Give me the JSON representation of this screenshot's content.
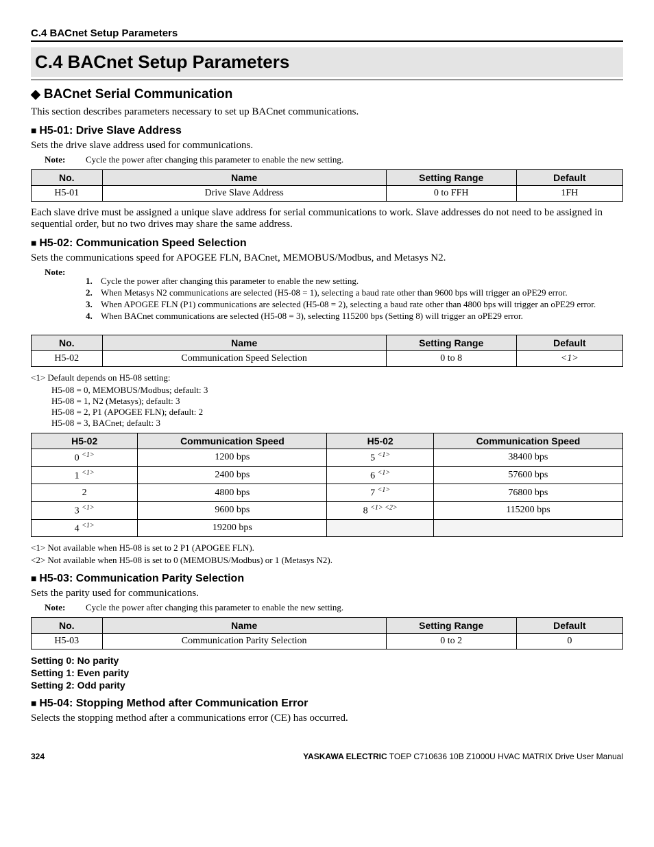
{
  "header": {
    "running_title": "C.4 BACnet Setup Parameters"
  },
  "title": "C.4   BACnet Setup Parameters",
  "s1": {
    "title": "BACnet Serial Communication",
    "intro": "This section describes parameters necessary to set up BACnet communications."
  },
  "h5_01": {
    "title": "H5-01: Drive Slave Address",
    "desc": "Sets the drive slave address used for communications.",
    "note": "Cycle the power after changing this parameter to enable the new setting.",
    "table": {
      "h_no": "No.",
      "h_name": "Name",
      "h_range": "Setting Range",
      "h_default": "Default",
      "no": "H5-01",
      "name": "Drive Slave Address",
      "range": "0 to FFH",
      "def": "1FH"
    },
    "after": "Each slave drive must be assigned a unique slave address for serial communications to work. Slave addresses do not need to be assigned in sequential order, but no two drives may share the same address."
  },
  "h5_02": {
    "title": "H5-02: Communication Speed Selection",
    "desc": "Sets the communications speed for APOGEE FLN, BACnet, MEMOBUS/Modbus, and Metasys N2.",
    "notes": [
      "Cycle the power after changing this parameter to enable the new setting.",
      "When Metasys N2 communications are selected (H5-08 = 1), selecting a baud rate other than 9600 bps will trigger an oPE29 error.",
      "When APOGEE FLN (P1) communications are selected (H5-08 = 2), selecting a baud rate other than 4800 bps will trigger an oPE29 error.",
      "When BACnet communications are selected (H5-08 = 3), selecting 115200 bps (Setting 8) will trigger an oPE29 error."
    ],
    "table": {
      "h_no": "No.",
      "h_name": "Name",
      "h_range": "Setting Range",
      "h_default": "Default",
      "no": "H5-02",
      "name": "Communication Speed Selection",
      "range": "0 to 8",
      "def": "<1>"
    },
    "fn1_lead": "<1>   Default depends on H5-08 setting:",
    "fn1_a": "H5-08 = 0, MEMOBUS/Modbus; default: 3",
    "fn1_b": "H5-08 = 1, N2 (Metasys); default: 3",
    "fn1_c": "H5-08 = 2, P1 (APOGEE FLN); default: 2",
    "fn1_d": "H5-08 = 3, BACnet; default: 3",
    "speed_table": {
      "h1": "H5-02",
      "h2": "Communication Speed",
      "h3": "H5-02",
      "h4": "Communication Speed",
      "rows": [
        {
          "a": "0",
          "ar": "<1>",
          "b": "1200 bps",
          "c": "5",
          "cr": "<1>",
          "d": "38400 bps"
        },
        {
          "a": "1",
          "ar": "<1>",
          "b": "2400 bps",
          "c": "6",
          "cr": "<1>",
          "d": "57600 bps"
        },
        {
          "a": "2",
          "ar": "",
          "b": "4800 bps",
          "c": "7",
          "cr": "<1>",
          "d": "76800 bps"
        },
        {
          "a": "3",
          "ar": "<1>",
          "b": "9600 bps",
          "c": "8",
          "cr": "<1> <2>",
          "d": "115200 bps"
        },
        {
          "a": "4",
          "ar": "<1>",
          "b": "19200 bps",
          "c": "",
          "cr": "",
          "d": ""
        }
      ]
    },
    "fn_after_a": "<1>   Not available when H5-08 is set to 2 P1 (APOGEE FLN).",
    "fn_after_b": "<2>   Not available when H5-08 is set to 0 (MEMOBUS/Modbus) or 1 (Metasys N2)."
  },
  "h5_03": {
    "title": "H5-03: Communication Parity Selection",
    "desc": "Sets the parity used for communications.",
    "note": "Cycle the power after changing this parameter to enable the new setting.",
    "table": {
      "h_no": "No.",
      "h_name": "Name",
      "h_range": "Setting Range",
      "h_default": "Default",
      "no": "H5-03",
      "name": "Communication Parity Selection",
      "range": "0 to 2",
      "def": "0"
    },
    "s0": "Setting 0: No parity",
    "s1": "Setting 1: Even parity",
    "s2": "Setting 2: Odd parity"
  },
  "h5_04": {
    "title": "H5-04: Stopping Method after Communication Error",
    "desc": "Selects the stopping method after a communications error (CE) has occurred."
  },
  "footer": {
    "page": "324",
    "vendor": "YASKAWA ELECTRIC",
    "doc": " TOEP C710636 10B Z1000U HVAC MATRIX Drive User Manual"
  }
}
